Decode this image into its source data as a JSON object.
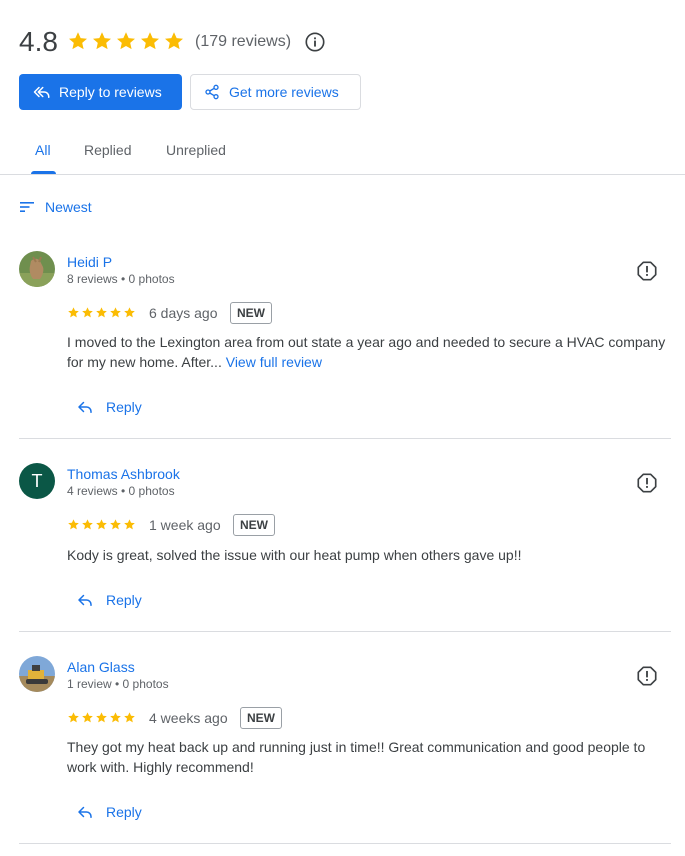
{
  "summary": {
    "rating": "4.8",
    "star_count": 5,
    "review_count": "(179 reviews)"
  },
  "actions": {
    "reply_to_reviews": "Reply to reviews",
    "get_more_reviews": "Get more reviews"
  },
  "tabs": [
    {
      "label": "All",
      "active": true
    },
    {
      "label": "Replied",
      "active": false
    },
    {
      "label": "Unreplied",
      "active": false
    }
  ],
  "sort": {
    "label": "Newest"
  },
  "reviews": [
    {
      "name": "Heidi P",
      "meta": "8 reviews • 0 photos",
      "stars": 5,
      "date": "6 days ago",
      "badge": "NEW",
      "text": "I moved to the Lexington area from out state a year ago and needed to secure a HVAC company for my new home. After...",
      "view_full": "View full review",
      "reply_label": "Reply"
    },
    {
      "name": "Thomas Ashbrook",
      "meta": "4 reviews • 0 photos",
      "avatar_initial": "T",
      "stars": 5,
      "date": "1 week ago",
      "badge": "NEW",
      "text": "Kody is great, solved the issue with our heat pump when others gave up!!",
      "reply_label": "Reply"
    },
    {
      "name": "Alan Glass",
      "meta": "1 review • 0 photos",
      "stars": 5,
      "date": "4 weeks ago",
      "badge": "NEW",
      "text": "They got my heat back up and running just in time!! Great communication and good people to work with. Highly recommend!",
      "reply_label": "Reply"
    }
  ],
  "colors": {
    "accent": "#1a73e8",
    "star": "#fbbc04",
    "avatar_thomas": "#0b5746"
  },
  "icons": [
    "star-icon",
    "info-icon",
    "reply-all-icon",
    "share-icon",
    "sort-icon",
    "flag-icon",
    "reply-icon"
  ]
}
